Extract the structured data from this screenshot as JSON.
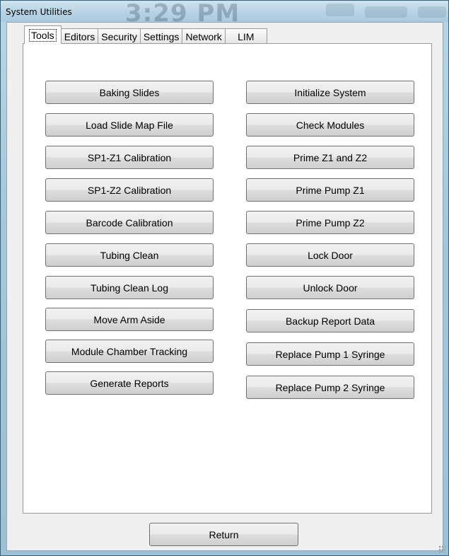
{
  "window": {
    "title": "System Utilities",
    "background_clock": "3:29 PM"
  },
  "tabs": [
    {
      "label": "Tools",
      "active": true
    },
    {
      "label": "Editors",
      "active": false
    },
    {
      "label": "Security",
      "active": false
    },
    {
      "label": "Settings",
      "active": false
    },
    {
      "label": "Network",
      "active": false
    },
    {
      "label": "LIM",
      "active": false
    }
  ],
  "tools": {
    "left": [
      "Baking Slides",
      "Load Slide Map File",
      "SP1-Z1 Calibration",
      "SP1-Z2 Calibration",
      "Barcode Calibration",
      "Tubing Clean",
      "Tubing Clean Log",
      "Move Arm Aside",
      "Module Chamber Tracking",
      "Generate Reports"
    ],
    "right": [
      "Initialize System",
      "Check Modules",
      "Prime Z1 and Z2",
      "Prime Pump Z1",
      "Prime Pump Z2",
      "Lock Door",
      "Unlock Door",
      "Backup Report Data",
      "Replace Pump 1 Syringe",
      "Replace Pump 2 Syringe"
    ]
  },
  "footer": {
    "return_label": "Return"
  }
}
